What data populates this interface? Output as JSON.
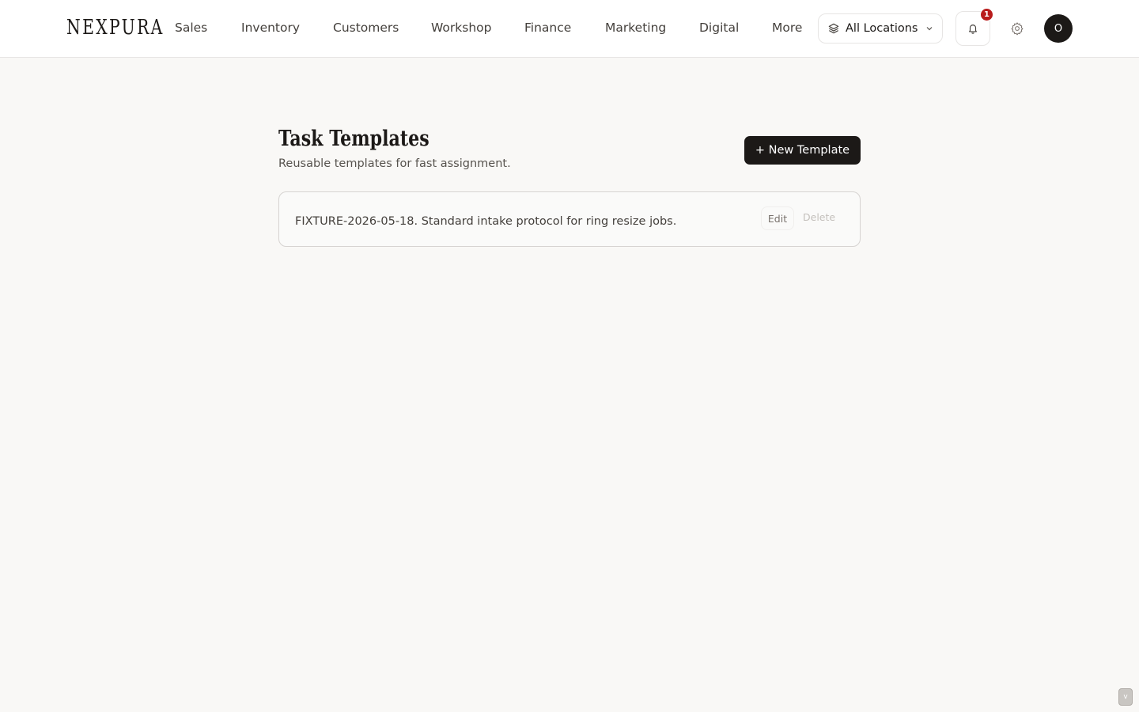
{
  "app": {
    "logo": "NEXPURA"
  },
  "nav": {
    "items": [
      {
        "label": "Sales"
      },
      {
        "label": "Inventory"
      },
      {
        "label": "Customers"
      },
      {
        "label": "Workshop"
      },
      {
        "label": "Finance"
      },
      {
        "label": "Marketing"
      },
      {
        "label": "Digital"
      },
      {
        "label": "More"
      }
    ]
  },
  "header": {
    "location_label": "All Locations",
    "notification_count": "1",
    "avatar_initial": "O"
  },
  "page": {
    "title": "Task Templates",
    "subtitle": "Reusable templates for fast assignment.",
    "new_button_label": "+ New Template"
  },
  "templates": [
    {
      "description": "FIXTURE-2026-05-18. Standard intake protocol for ring resize jobs.",
      "edit_label": "Edit",
      "delete_label": "Delete"
    }
  ],
  "corner": {
    "label": "v"
  },
  "colors": {
    "background": "#f9f8f6",
    "primary": "#1c1917",
    "badge": "#b91c1c"
  }
}
